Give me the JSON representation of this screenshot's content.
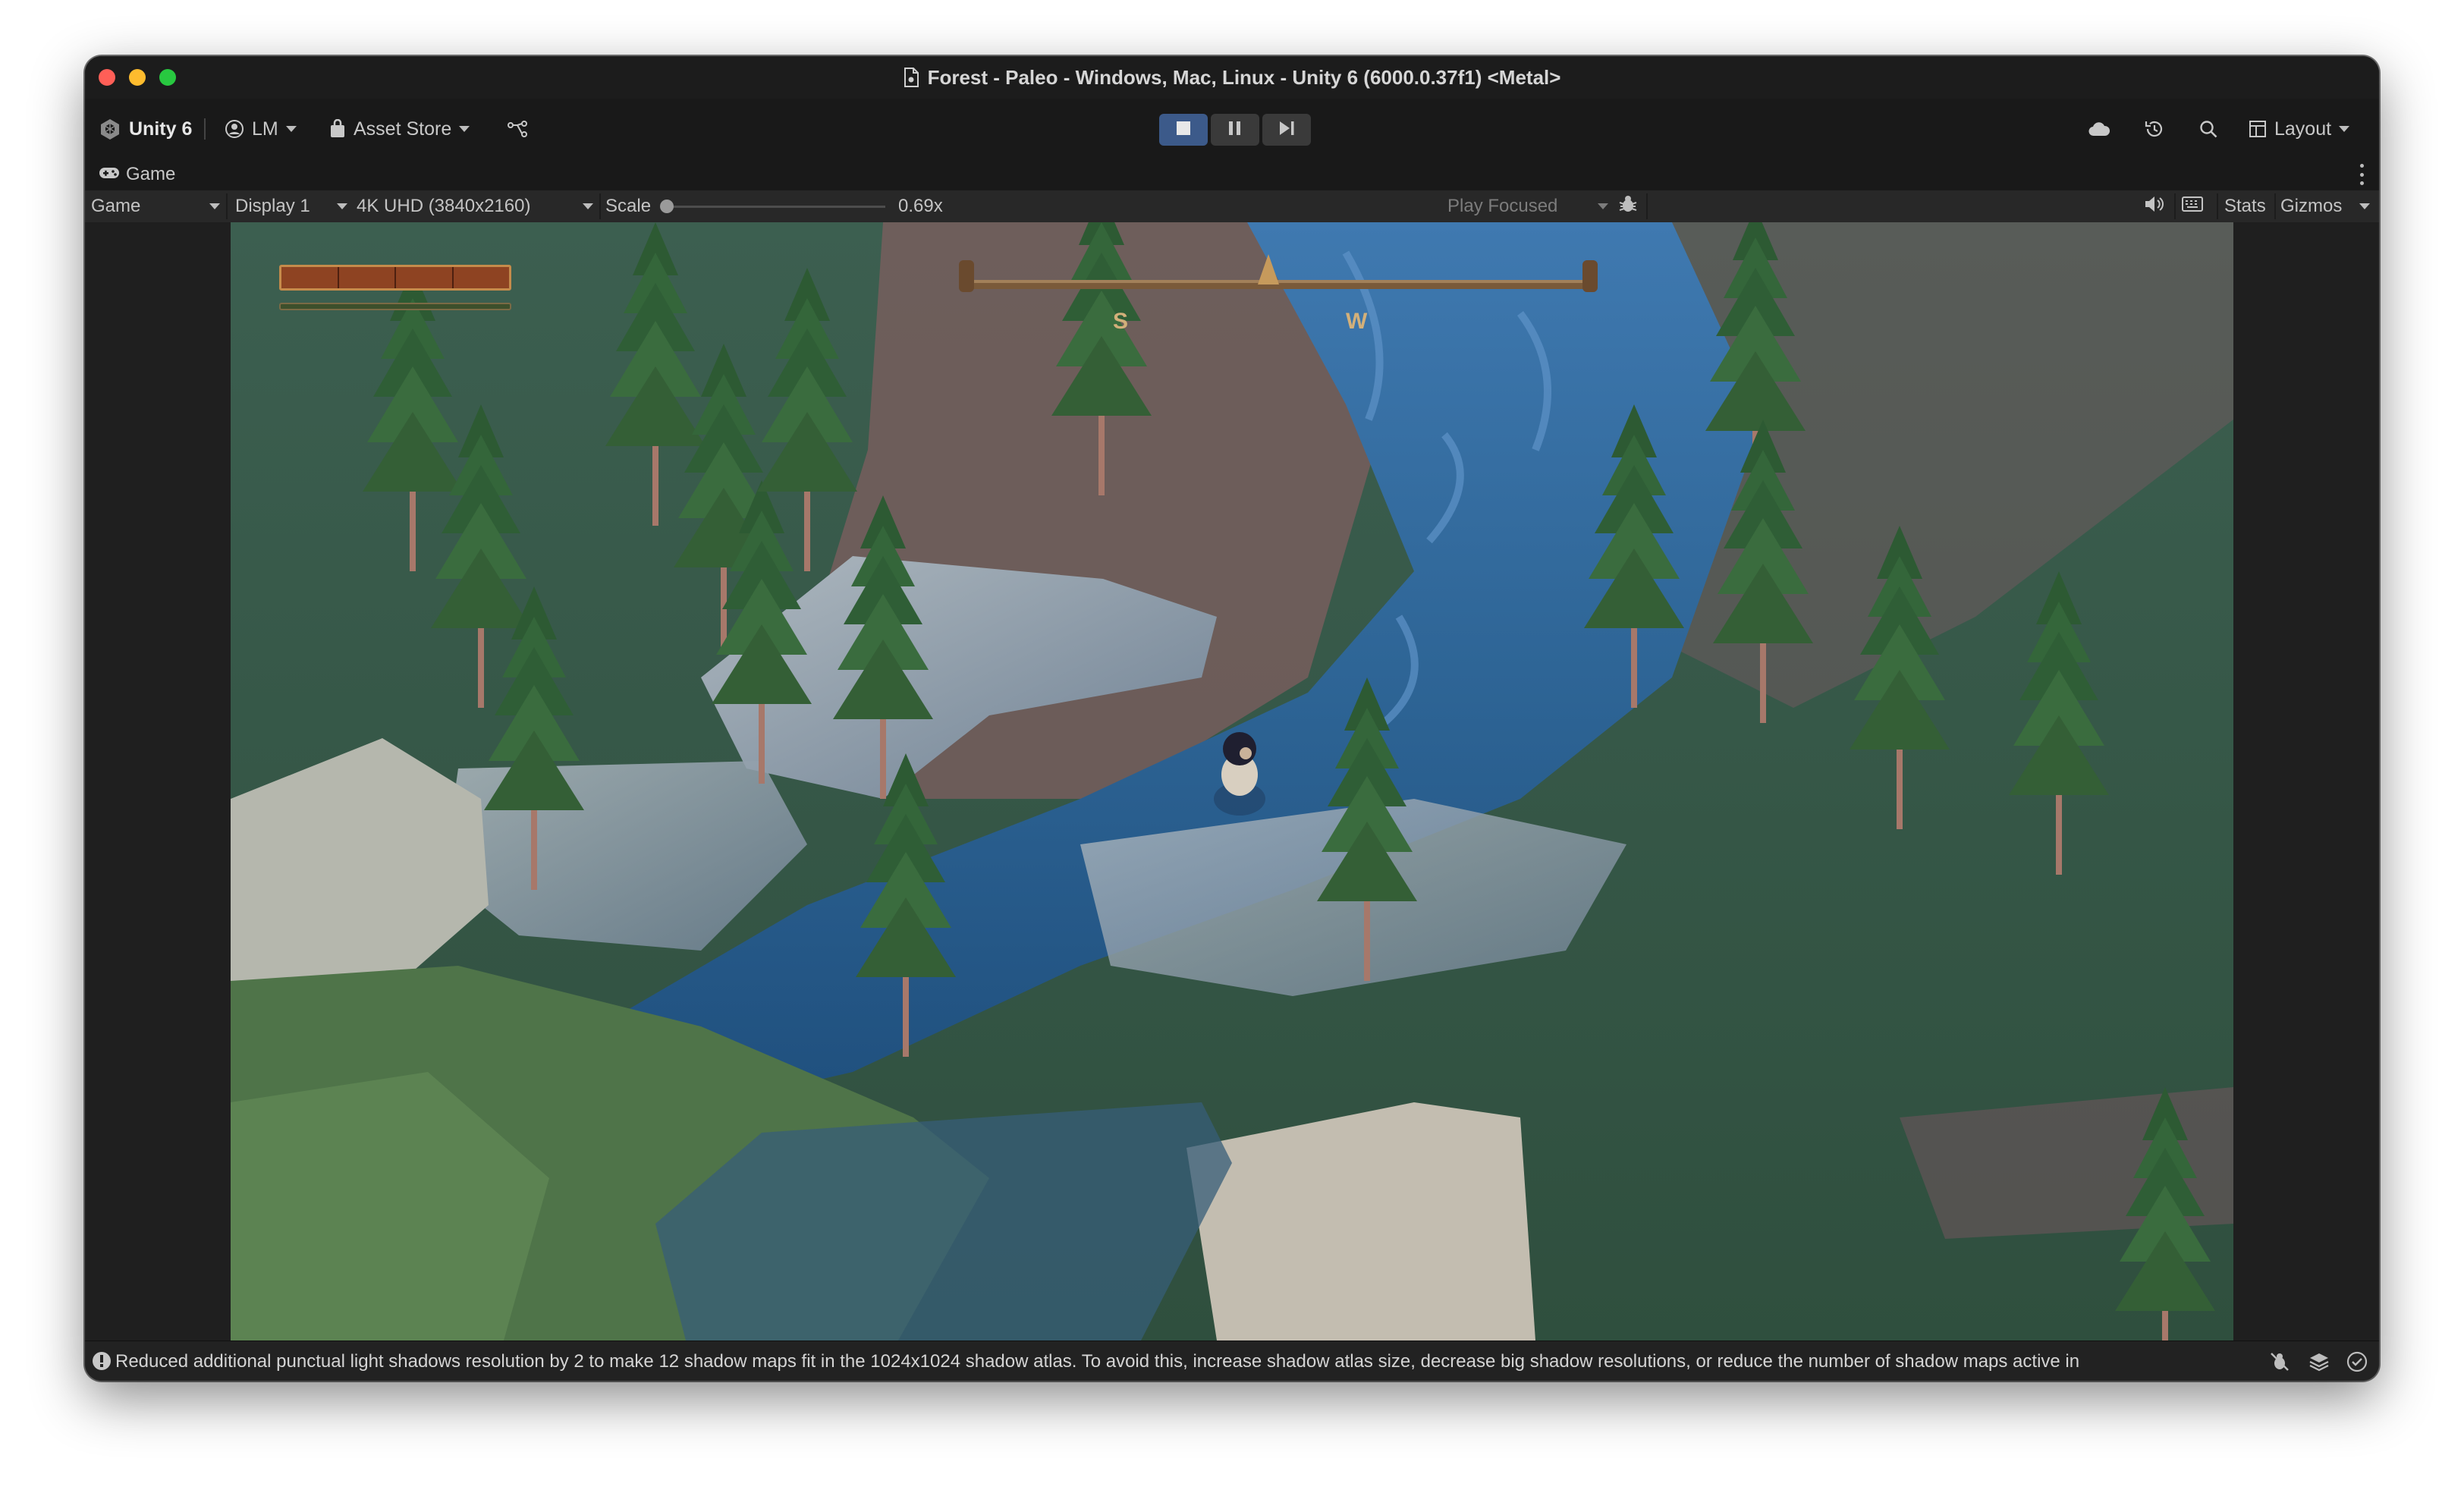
{
  "window": {
    "title": "Forest - Paleo - Windows, Mac, Linux - Unity 6 (6000.0.37f1) <Metal>"
  },
  "toolbar": {
    "unity_label": "Unity 6",
    "account_label": "LM",
    "asset_store_label": "Asset Store",
    "layout_label": "Layout"
  },
  "tab": {
    "label": "Game"
  },
  "game_toolbar": {
    "mode": "Game",
    "display": "Display 1",
    "resolution": "4K UHD (3840x2160)",
    "scale_label": "Scale",
    "scale_value": "0.69x",
    "play_mode": "Play Focused",
    "stats_label": "Stats",
    "gizmos_label": "Gizmos"
  },
  "hud": {
    "compass_letters": [
      "S",
      "W"
    ]
  },
  "status": {
    "message": "Reduced additional punctual light shadows resolution by 2 to make 12 shadow maps fit in the 1024x1024 shadow atlas. To avoid this, increase shadow atlas size, decrease big shadow resolutions, or reduce the number of shadow maps active in"
  },
  "colors": {
    "play_button_active": "#3c5a8a",
    "health_bar": "#9c4a22",
    "compass_wood": "#7a5a3a",
    "water": "#2b5f8f",
    "grass": "#3c5f48"
  }
}
